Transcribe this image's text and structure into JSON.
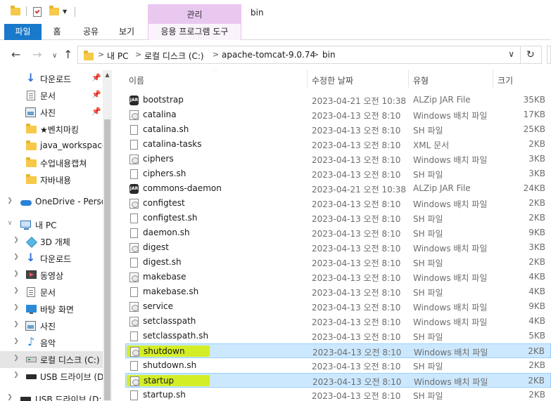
{
  "title_bar": {
    "context_tab_header": "관리",
    "window_title": "bin"
  },
  "ribbon": {
    "tabs": [
      "파일",
      "홈",
      "공유",
      "보기",
      "응용 프로그램 도구"
    ]
  },
  "address": {
    "crumbs": [
      "내 PC",
      "로컬 디스크 (C:)",
      "apache-tomcat-9.0.74",
      "bin"
    ],
    "separator": ">"
  },
  "sidebar": {
    "items": [
      {
        "label": "다운로드",
        "icon": "download-icon",
        "pinned": true
      },
      {
        "label": "문서",
        "icon": "document-icon",
        "pinned": true
      },
      {
        "label": "사진",
        "icon": "picture-icon",
        "pinned": true
      },
      {
        "label": "★벤치마킹",
        "icon": "folder-icon",
        "pinned": false
      },
      {
        "label": "java_workspace",
        "icon": "folder-icon",
        "pinned": false
      },
      {
        "label": "수업내용캡쳐",
        "icon": "folder-icon",
        "pinned": false
      },
      {
        "label": "자바내용",
        "icon": "folder-icon",
        "pinned": false
      },
      {
        "label": "OneDrive - Perso",
        "icon": "onedrive-icon",
        "pinned": false
      },
      {
        "label": "내 PC",
        "icon": "pc-icon",
        "pinned": false
      },
      {
        "label": "3D 개체",
        "icon": "3d-objects-icon",
        "pinned": false
      },
      {
        "label": "다운로드",
        "icon": "download-icon",
        "pinned": false
      },
      {
        "label": "동영상",
        "icon": "video-icon",
        "pinned": false
      },
      {
        "label": "문서",
        "icon": "document-icon",
        "pinned": false
      },
      {
        "label": "바탕 화면",
        "icon": "desktop-icon",
        "pinned": false
      },
      {
        "label": "사진",
        "icon": "picture-icon",
        "pinned": false
      },
      {
        "label": "음악",
        "icon": "music-icon",
        "pinned": false
      },
      {
        "label": "로컬 디스크 (C:)",
        "icon": "drive-icon",
        "pinned": false
      },
      {
        "label": "USB 드라이브 (D",
        "icon": "usb-drive-icon",
        "pinned": false
      },
      {
        "label": "USB 드라이브 (D:",
        "icon": "usb-drive-icon",
        "pinned": false
      }
    ]
  },
  "columns": {
    "name": "이름",
    "date": "수정한 날짜",
    "type": "유형",
    "size": "크기"
  },
  "files": [
    {
      "name": "bootstrap",
      "date": "2023-04-21 오전 10:38",
      "type": "ALZip JAR File",
      "size": "35KB",
      "icon": "jar-icon"
    },
    {
      "name": "catalina",
      "date": "2023-04-13 오전 8:10",
      "type": "Windows 배치 파일",
      "size": "17KB",
      "icon": "batch-icon"
    },
    {
      "name": "catalina.sh",
      "date": "2023-04-13 오전 8:10",
      "type": "SH 파일",
      "size": "25KB",
      "icon": "file-icon"
    },
    {
      "name": "catalina-tasks",
      "date": "2023-04-13 오전 8:10",
      "type": "XML 문서",
      "size": "2KB",
      "icon": "file-icon"
    },
    {
      "name": "ciphers",
      "date": "2023-04-13 오전 8:10",
      "type": "Windows 배치 파일",
      "size": "3KB",
      "icon": "batch-icon"
    },
    {
      "name": "ciphers.sh",
      "date": "2023-04-13 오전 8:10",
      "type": "SH 파일",
      "size": "3KB",
      "icon": "file-icon"
    },
    {
      "name": "commons-daemon",
      "date": "2023-04-21 오전 10:38",
      "type": "ALZip JAR File",
      "size": "24KB",
      "icon": "jar-icon"
    },
    {
      "name": "configtest",
      "date": "2023-04-13 오전 8:10",
      "type": "Windows 배치 파일",
      "size": "2KB",
      "icon": "batch-icon"
    },
    {
      "name": "configtest.sh",
      "date": "2023-04-13 오전 8:10",
      "type": "SH 파일",
      "size": "2KB",
      "icon": "file-icon"
    },
    {
      "name": "daemon.sh",
      "date": "2023-04-13 오전 8:10",
      "type": "SH 파일",
      "size": "9KB",
      "icon": "file-icon"
    },
    {
      "name": "digest",
      "date": "2023-04-13 오전 8:10",
      "type": "Windows 배치 파일",
      "size": "3KB",
      "icon": "batch-icon"
    },
    {
      "name": "digest.sh",
      "date": "2023-04-13 오전 8:10",
      "type": "SH 파일",
      "size": "2KB",
      "icon": "file-icon"
    },
    {
      "name": "makebase",
      "date": "2023-04-13 오전 8:10",
      "type": "Windows 배치 파일",
      "size": "4KB",
      "icon": "batch-icon"
    },
    {
      "name": "makebase.sh",
      "date": "2023-04-13 오전 8:10",
      "type": "SH 파일",
      "size": "4KB",
      "icon": "file-icon"
    },
    {
      "name": "service",
      "date": "2023-04-13 오전 8:10",
      "type": "Windows 배치 파일",
      "size": "9KB",
      "icon": "batch-icon"
    },
    {
      "name": "setclasspath",
      "date": "2023-04-13 오전 8:10",
      "type": "Windows 배치 파일",
      "size": "4KB",
      "icon": "batch-icon"
    },
    {
      "name": "setclasspath.sh",
      "date": "2023-04-13 오전 8:10",
      "type": "SH 파일",
      "size": "5KB",
      "icon": "file-icon"
    },
    {
      "name": "shutdown",
      "date": "2023-04-13 오전 8:10",
      "type": "Windows 배치 파일",
      "size": "2KB",
      "icon": "batch-icon",
      "selected": true,
      "highlighted": true
    },
    {
      "name": "shutdown.sh",
      "date": "2023-04-13 오전 8:10",
      "type": "SH 파일",
      "size": "2KB",
      "icon": "file-icon"
    },
    {
      "name": "startup",
      "date": "2023-04-13 오전 8:10",
      "type": "Windows 배치 파일",
      "size": "2KB",
      "icon": "batch-icon",
      "selected": true,
      "highlighted": true
    },
    {
      "name": "startup.sh",
      "date": "2023-04-13 오전 8:10",
      "type": "SH 파일",
      "size": "2KB",
      "icon": "file-icon"
    }
  ],
  "colors": {
    "file_tab": "#1979ca",
    "context_tab": "#e9c8f0",
    "selection": "#cce8ff",
    "highlight_marker": "#d4ef00"
  }
}
